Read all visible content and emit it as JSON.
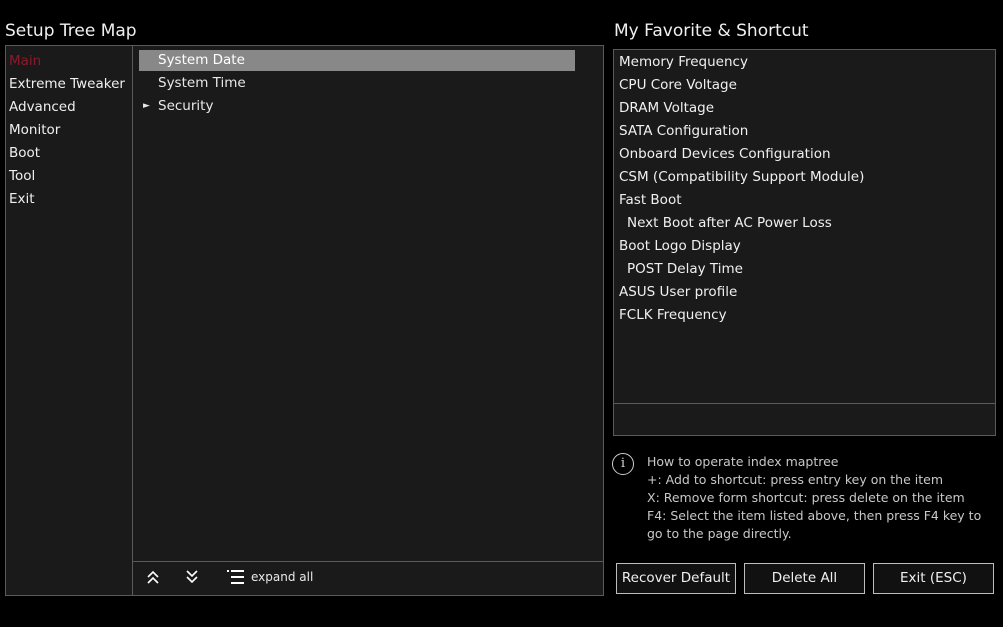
{
  "left": {
    "title": "Setup Tree Map",
    "categories": [
      "Main",
      "Extreme Tweaker",
      "Advanced",
      "Monitor",
      "Boot",
      "Tool",
      "Exit"
    ],
    "tree": [
      {
        "label": "System Date"
      },
      {
        "label": "System Time"
      },
      {
        "label": "Security"
      }
    ],
    "footer": {
      "collapse_icon": "double-chevron-up-icon",
      "expand_icon": "double-chevron-down-icon",
      "list_icon": "list-icon",
      "expand_all": "expand all"
    }
  },
  "right": {
    "title": "My Favorite & Shortcut",
    "favorites": [
      "Memory Frequency",
      "CPU Core Voltage",
      "DRAM Voltage",
      "SATA Configuration",
      "Onboard Devices Configuration",
      "CSM (Compatibility Support Module)",
      "Fast Boot",
      "Next Boot after AC Power Loss",
      "Boot Logo Display",
      "POST Delay Time",
      "ASUS User profile",
      "FCLK Frequency"
    ],
    "help": {
      "icon": "info-icon",
      "lines": [
        "How to operate index maptree",
        "+: Add to shortcut: press entry key on the item",
        "X: Remove form shortcut: press delete on the item",
        "F4: Select the item listed above, then press F4 key to",
        "go to the page directly."
      ]
    },
    "buttons": {
      "recover": "Recover Default",
      "delete": "Delete All",
      "exit": "Exit (ESC)"
    }
  },
  "colors": {
    "active_category": "#8b1a2b",
    "selection": "#888888",
    "background": "#000000"
  }
}
